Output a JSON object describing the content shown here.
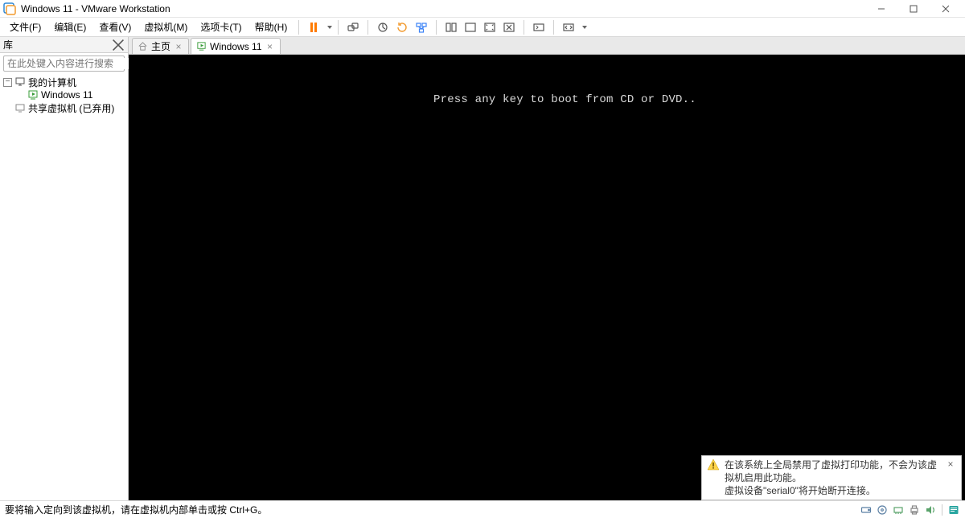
{
  "title": "Windows 11 - VMware Workstation",
  "menubar": {
    "file": "文件(F)",
    "edit": "编辑(E)",
    "view": "查看(V)",
    "vm": "虚拟机(M)",
    "tabs": "选项卡(T)",
    "help": "帮助(H)"
  },
  "sidebar": {
    "header": "库",
    "search_placeholder": "在此处键入内容进行搜索",
    "my_computer": "我的计算机",
    "vm_name": "Windows 11",
    "shared_vms": "共享虚拟机 (已弃用)"
  },
  "tabs": {
    "home": "主页",
    "vm": "Windows 11"
  },
  "vm_screen_text": "Press any key to boot from CD or DVD..",
  "statusbar_text": "要将输入定向到该虚拟机，请在虚拟机内部单击或按 Ctrl+G。",
  "toast": {
    "line1": "在该系统上全局禁用了虚拟打印功能，不会为该虚拟机启用此功能。",
    "line2_pre": "虚拟设备",
    "line2_dev": "\"serial0\"",
    "line2_post": "将开始断开连接。"
  }
}
